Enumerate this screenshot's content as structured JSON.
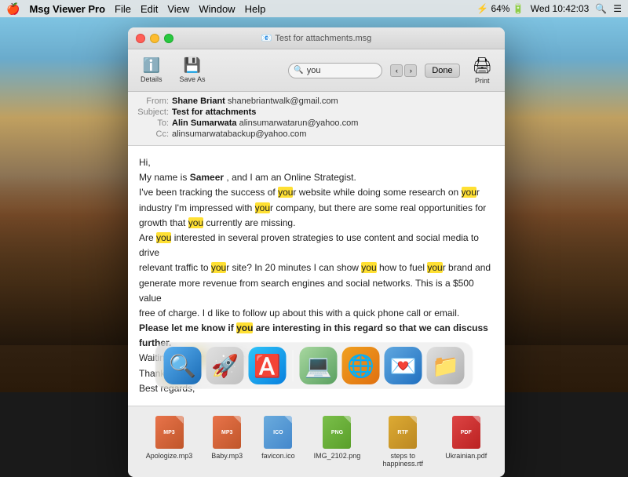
{
  "menubar": {
    "apple": "🍎",
    "app_name": "Msg Viewer Pro",
    "menus": [
      "File",
      "Edit",
      "View",
      "Window",
      "Help"
    ],
    "right_items": [
      "⚡/",
      "64%",
      "🔋",
      "Wed 10:42:03",
      "🔍",
      "☰"
    ]
  },
  "window": {
    "title_icon": "📧",
    "title": "Test for attachments.msg"
  },
  "toolbar": {
    "details_label": "Details",
    "save_as_label": "Save As",
    "print_label": "Print",
    "search_placeholder": "you",
    "done_label": "Done"
  },
  "email": {
    "from_label": "From:",
    "from_name": "Shane Briant",
    "from_email": "shanebriantwalk@gmail.com",
    "subject_label": "Subject:",
    "subject": "Test for attachments",
    "to_label": "To:",
    "to_name": "Alin Sumarwata",
    "to_email": "alinsumarwatarun@yahoo.com",
    "cc_label": "Cc:",
    "cc_email": "alinsumarwatabackup@yahoo.com",
    "body_lines": [
      "Hi,",
      "My name is Sameer , and I am an Online Strategist.",
      "I've been tracking the success of your website while doing some research on your",
      "industry I'm impressed with your company, but there are some real opportunities for",
      "growth that you currently are missing.",
      "Are you interested in several proven strategies to use content and social media to drive",
      "relevant traffic to your site? In 20 minutes I can show you how to fuel your brand and",
      "generate more revenue from search engines and social networks. This is a $500 value",
      "free of charge. I d like to follow up about this with a quick phone call or email.",
      "Please let me know if you are interesting in this regard so that we can discuss",
      "further.",
      "Waiting for your response",
      "Thank you",
      "Best regards,"
    ]
  },
  "attachments": [
    {
      "icon_type": "mp3",
      "name": "Apologize.mp3"
    },
    {
      "icon_type": "mp3",
      "name": "Baby.mp3"
    },
    {
      "icon_type": "ico",
      "name": "favicon.ico"
    },
    {
      "icon_type": "png",
      "name": "IMG_2102.png"
    },
    {
      "icon_type": "rtf",
      "name": "steps to\nhappiness.rtf"
    },
    {
      "icon_type": "pdf",
      "name": "Ukrainian.pdf"
    }
  ],
  "dock": {
    "icons": [
      "🔍",
      "🚀",
      "🅰️",
      "💻",
      "🌐",
      "💌",
      "📁"
    ]
  },
  "colors": {
    "highlight_yellow": "#FFE033",
    "window_bg": "#f5f5f5",
    "toolbar_bg": "#e8e8e8"
  }
}
